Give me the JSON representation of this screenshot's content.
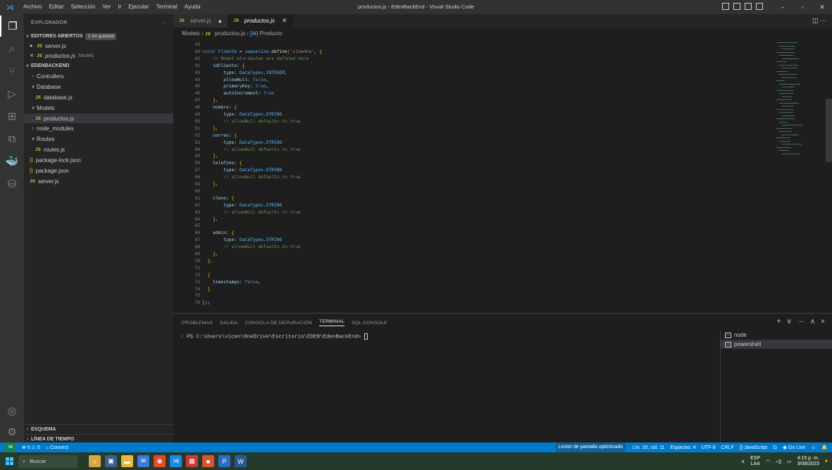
{
  "titlebar": {
    "menu": [
      "Archivo",
      "Editar",
      "Selección",
      "Ver",
      "Ir",
      "Ejecutar",
      "Terminal",
      "Ayuda"
    ],
    "window_title": "productos.js - EdenBackEnd - Visual Studio Code"
  },
  "sidebar": {
    "header": "EXPLORADOR",
    "more": "···",
    "open_editors": {
      "label": "EDITORES ABIERTOS",
      "badge": "1 sin guardar",
      "items": [
        {
          "name": "server.js",
          "detail": ""
        },
        {
          "name": "productos.js",
          "detail": "Models"
        }
      ]
    },
    "project": {
      "label": "EDENBACKEND",
      "items": [
        {
          "name": "Controllers",
          "kind": "folder",
          "expanded": false
        },
        {
          "name": "Database",
          "kind": "folder",
          "expanded": true
        },
        {
          "name": "database.js",
          "kind": "js"
        },
        {
          "name": "Models",
          "kind": "folder",
          "expanded": true
        },
        {
          "name": "productos.js",
          "kind": "js"
        },
        {
          "name": "node_modules",
          "kind": "folder",
          "expanded": false
        },
        {
          "name": "Routes",
          "kind": "folder",
          "expanded": true
        },
        {
          "name": "routes.js",
          "kind": "js"
        },
        {
          "name": "package-lock.json",
          "kind": "json"
        },
        {
          "name": "package.json",
          "kind": "json"
        },
        {
          "name": "server.js",
          "kind": "js"
        }
      ]
    },
    "outline": "ESQUEMA",
    "timeline": "LÍNEA DE TIEMPO"
  },
  "tabs": [
    {
      "label": "server.js",
      "modified": true
    },
    {
      "label": "productos.js",
      "modified": false
    }
  ],
  "breadcrumb": {
    "folder": "Models",
    "file": "productos.js",
    "symbol": "Producto"
  },
  "code": {
    "lines": [
      {
        "n": "39",
        "t": ""
      },
      {
        "n": "40",
        "t": "const Cliente = sequelize.define('cliente', {"
      },
      {
        "n": "41",
        "t": "    // Model attributes are defined here"
      },
      {
        "n": "42",
        "t": "    idCliente: {"
      },
      {
        "n": "43",
        "t": "        type: DataTypes.INTEGER,"
      },
      {
        "n": "44",
        "t": "        allowNull: false,"
      },
      {
        "n": "45",
        "t": "        primaryKey: true,"
      },
      {
        "n": "46",
        "t": "        autoIncrement: true"
      },
      {
        "n": "47",
        "t": "    },"
      },
      {
        "n": "48",
        "t": "    nombre: {"
      },
      {
        "n": "49",
        "t": "        type: DataTypes.STRING"
      },
      {
        "n": "50",
        "t": "        // allowNull defaults to true"
      },
      {
        "n": "51",
        "t": "    },"
      },
      {
        "n": "52",
        "t": "    correo: {"
      },
      {
        "n": "53",
        "t": "        type: DataTypes.STRING"
      },
      {
        "n": "54",
        "t": "        // allowNull defaults to true"
      },
      {
        "n": "55",
        "t": "    },"
      },
      {
        "n": "56",
        "t": "    telefono: {"
      },
      {
        "n": "57",
        "t": "        type: DataTypes.STRING"
      },
      {
        "n": "58",
        "t": "        // allowNull defaults to true"
      },
      {
        "n": "59",
        "t": "    },"
      },
      {
        "n": "60",
        "t": ""
      },
      {
        "n": "61",
        "t": "    clave: {"
      },
      {
        "n": "62",
        "t": "        type: DataTypes.STRING"
      },
      {
        "n": "63",
        "t": "        // allowNull defaults to true"
      },
      {
        "n": "64",
        "t": "    },"
      },
      {
        "n": "65",
        "t": ""
      },
      {
        "n": "66",
        "t": "    admin: {"
      },
      {
        "n": "67",
        "t": "        type: DataTypes.STRING"
      },
      {
        "n": "68",
        "t": "        // allowNull defaults to true"
      },
      {
        "n": "69",
        "t": "    },"
      },
      {
        "n": "70",
        "t": "  },"
      },
      {
        "n": "71",
        "t": ""
      },
      {
        "n": "72",
        "t": "  {"
      },
      {
        "n": "73",
        "t": "    timestamps: false,"
      },
      {
        "n": "74",
        "t": "  }"
      },
      {
        "n": "75",
        "t": ""
      },
      {
        "n": "76",
        "t": "});"
      }
    ]
  },
  "panel": {
    "tabs": [
      "PROBLEMAS",
      "SALIDA",
      "CONSOLA DE DEPURACIÓN",
      "TERMINAL",
      "SQL CONSOLE"
    ],
    "active_tab": "TERMINAL",
    "actions": [
      "+",
      "∨",
      "···",
      "∧",
      "×"
    ],
    "terminal_prompt": "PS C:\\Users\\vicen\\OneDrive\\Escritorio\\EDEN\\EdenBackEnd>",
    "terminals": [
      "node",
      "powershell"
    ]
  },
  "statusbar": {
    "problems": "⊗ 0 ⚠ 0",
    "connect": "Connect",
    "a11y": "Lector de pantalla optimizado",
    "position": "Lín. 20, col. 11",
    "spaces": "Espacios: 4",
    "encoding": "UTF-8",
    "eol": "CRLF",
    "language": "JavaScript",
    "golive": "Go Live"
  },
  "taskbar": {
    "search_placeholder": "Buscar",
    "lang_top": "ESP",
    "lang_bottom": "LAA",
    "time": "4:15 p. m.",
    "date": "3/08/2023"
  },
  "colors": {
    "accent": "#007acc",
    "js_icon": "#cbcb41",
    "keyword": "#569cd6",
    "comment": "#6a9955"
  }
}
